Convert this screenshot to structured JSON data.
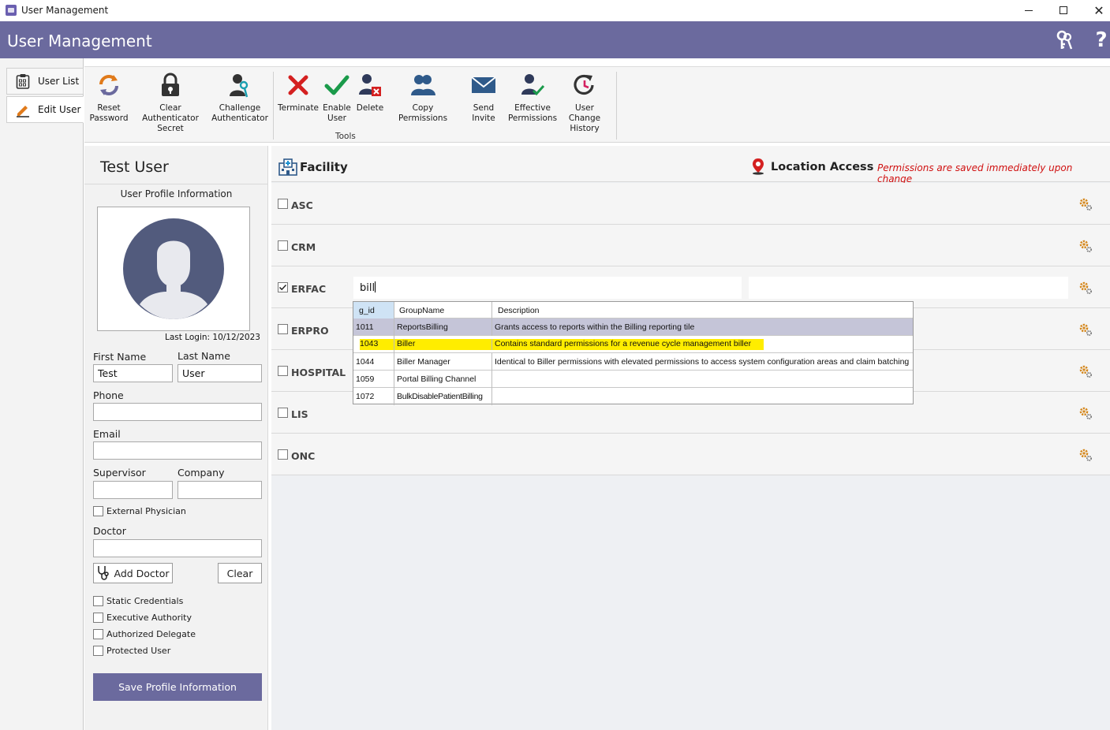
{
  "window": {
    "title": "User Management"
  },
  "header": {
    "title": "User Management"
  },
  "left_tabs": [
    {
      "label": "User List",
      "icon": "clipboard-icon"
    },
    {
      "label": "Edit User",
      "icon": "pencil-icon"
    }
  ],
  "toolbar": {
    "buttons": [
      {
        "label": "Reset\nPassword",
        "icon": "refresh-icon"
      },
      {
        "label": "Clear Authenticator\nSecret",
        "icon": "lock-icon"
      },
      {
        "label": "Challenge\nAuthenticator",
        "icon": "user-key-icon"
      },
      {
        "label": "Terminate",
        "icon": "red-x-icon"
      },
      {
        "label": "Enable\nUser",
        "icon": "green-check-icon"
      },
      {
        "label": "Delete",
        "icon": "user-delete-icon"
      },
      {
        "label": "Copy Permissions",
        "icon": "users-icon"
      },
      {
        "label": "Send Invite",
        "icon": "envelope-icon"
      },
      {
        "label": "Effective\nPermissions",
        "icon": "user-check-icon"
      },
      {
        "label": "User Change\nHistory",
        "icon": "history-icon"
      }
    ],
    "group_caption": "Tools"
  },
  "profile": {
    "name": "Test User",
    "section_title": "User Profile Information",
    "last_login": "Last Login: 10/12/2023",
    "first_name_label": "First Name",
    "first_name": "Test",
    "last_name_label": "Last Name",
    "last_name": "User",
    "phone_label": "Phone",
    "phone": "",
    "email_label": "Email",
    "email": "",
    "supervisor_label": "Supervisor",
    "supervisor": "",
    "company_label": "Company",
    "company": "",
    "external_physician_label": "External Physician",
    "doctor_label": "Doctor",
    "doctor": "",
    "add_doctor_label": "Add Doctor",
    "clear_label": "Clear",
    "flags": [
      "Static Credentials",
      "Executive Authority",
      "Authorized Delegate",
      "Protected User"
    ],
    "save_label": "Save Profile Information"
  },
  "facility": {
    "title": "Facility",
    "location_title": "Location Access",
    "warning": "Permissions are saved immediately upon change",
    "rows": [
      {
        "name": "ASC",
        "checked": false
      },
      {
        "name": "CRM",
        "checked": false
      },
      {
        "name": "ERFAC",
        "checked": true
      },
      {
        "name": "ERPRO",
        "checked": false
      },
      {
        "name": "HOSPITAL",
        "checked": false
      },
      {
        "name": "LIS",
        "checked": false
      },
      {
        "name": "ONC",
        "checked": false
      }
    ],
    "search_value": "bill"
  },
  "dropdown": {
    "columns": [
      "g_id",
      "GroupName",
      "Description"
    ],
    "rows": [
      {
        "g_id": "1011",
        "group": "ReportsBilling",
        "description": "Grants access to reports within the Billing reporting tile"
      },
      {
        "g_id": "1043",
        "group": "Biller",
        "description": "Contains standard permissions for a revenue cycle management biller"
      },
      {
        "g_id": "1044",
        "group": "Biller Manager",
        "description": "Identical to Biller permissions with elevated permissions to access system configuration areas and claim batching"
      },
      {
        "g_id": "1059",
        "group": "Portal Billing Channel",
        "description": ""
      },
      {
        "g_id": "1072",
        "group": "BulkDisablePatientBilling",
        "description": ""
      }
    ]
  },
  "colors": {
    "header": "#6b6a9e",
    "warning": "#d01010",
    "highlight": "#ffed00",
    "selected_row": "#c5c5d8"
  }
}
